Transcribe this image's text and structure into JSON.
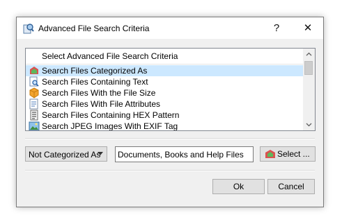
{
  "window": {
    "title": "Advanced File Search Criteria",
    "help_label": "?",
    "close_label": "✕"
  },
  "criteria_list": {
    "header": "Select Advanced File Search Criteria",
    "items": [
      {
        "label": "Search Files Categorized As",
        "icon": "category-icon",
        "selected": true
      },
      {
        "label": "Search Files Containing Text",
        "icon": "text-search-icon",
        "selected": false
      },
      {
        "label": "Search Files With the File Size",
        "icon": "file-size-icon",
        "selected": false
      },
      {
        "label": "Search Files With File Attributes",
        "icon": "file-attributes-icon",
        "selected": false
      },
      {
        "label": "Search Files Containing HEX Pattern",
        "icon": "hex-pattern-icon",
        "selected": false
      },
      {
        "label": "Search JPEG Images With EXIF Tag",
        "icon": "image-exif-icon",
        "selected": false
      }
    ]
  },
  "filter": {
    "mode_value": "Not Categorized As",
    "category_value": "Documents, Books and Help Files",
    "select_label": "Select ..."
  },
  "footer": {
    "ok_label": "Ok",
    "cancel_label": "Cancel"
  },
  "colors": {
    "selection": "#cce8ff",
    "dialog_bg": "#f0f0f0",
    "button_bg": "#e1e1e1"
  }
}
